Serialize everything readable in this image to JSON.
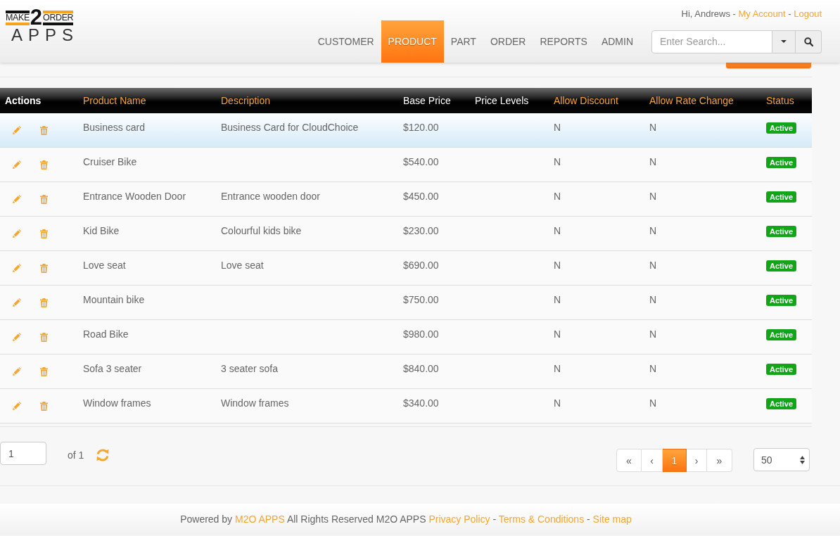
{
  "header": {
    "logo": {
      "left_word": "MAKE",
      "numeral": "2",
      "right_word": "ORDER",
      "bottom_word": "APPS"
    },
    "user_menu": [
      {
        "kind": "text",
        "text": "Hi, Andrews - "
      },
      {
        "kind": "link",
        "text": "My Account"
      },
      {
        "kind": "text",
        "text": " - "
      },
      {
        "kind": "link",
        "text": "Logout"
      }
    ],
    "nav": [
      {
        "label": "CUSTOMER",
        "selected": false
      },
      {
        "label": "PRODUCT",
        "selected": true
      },
      {
        "label": "PART",
        "selected": false
      },
      {
        "label": "ORDER",
        "selected": false
      },
      {
        "label": "REPORTS",
        "selected": false
      },
      {
        "label": "ADMIN",
        "selected": false
      }
    ],
    "search": {
      "placeholder": "Enter Search..."
    }
  },
  "table": {
    "columns": [
      {
        "label": "Actions",
        "kind": "actions",
        "sortable": false
      },
      {
        "label": "Product Name",
        "kind": "text",
        "sortable": true
      },
      {
        "label": "Description",
        "kind": "text",
        "sortable": true
      },
      {
        "label": "Base Price",
        "kind": "text",
        "sortable": false
      },
      {
        "label": "Price Levels",
        "kind": "text",
        "sortable": false
      },
      {
        "label": "Allow Discount",
        "kind": "text",
        "sortable": true
      },
      {
        "label": "Allow Rate Change",
        "kind": "text",
        "sortable": true
      },
      {
        "label": "Status",
        "kind": "status",
        "sortable": true
      }
    ],
    "rows": [
      {
        "selected": true,
        "product_name": "Business card",
        "description": "Business Card for CloudChoice",
        "base_price": "$120.00",
        "allow_discount": "N",
        "allow_rate_change": "N",
        "status": "Active"
      },
      {
        "selected": false,
        "product_name": "Cruiser Bike",
        "base_price": "$540.00",
        "allow_discount": "N",
        "allow_rate_change": "N",
        "status": "Active"
      },
      {
        "selected": false,
        "product_name": "Entrance Wooden Door",
        "description": "Entrance wooden door",
        "base_price": "$450.00",
        "allow_discount": "N",
        "allow_rate_change": "N",
        "status": "Active"
      },
      {
        "selected": false,
        "product_name": "Kid Bike",
        "description": "Colourful kids bike",
        "base_price": "$230.00",
        "allow_discount": "N",
        "allow_rate_change": "N",
        "status": "Active"
      },
      {
        "selected": false,
        "product_name": "Love seat",
        "description": "Love seat",
        "base_price": "$690.00",
        "allow_discount": "N",
        "allow_rate_change": "N",
        "status": "Active"
      },
      {
        "selected": false,
        "product_name": "Mountain bike",
        "base_price": "$750.00",
        "allow_discount": "N",
        "allow_rate_change": "N",
        "status": "Active"
      },
      {
        "selected": false,
        "product_name": "Road Bike",
        "base_price": "$980.00",
        "allow_discount": "N",
        "allow_rate_change": "N",
        "status": "Active"
      },
      {
        "selected": false,
        "product_name": "Sofa 3 seater",
        "description": "3 seater sofa",
        "base_price": "$840.00",
        "allow_discount": "N",
        "allow_rate_change": "N",
        "status": "Active"
      },
      {
        "selected": false,
        "product_name": "Window frames",
        "description": "Window frames",
        "base_price": "$340.00",
        "allow_discount": "N",
        "allow_rate_change": "N",
        "status": "Active"
      }
    ]
  },
  "pager": {
    "page": "1",
    "total": "of 1",
    "buttons": [
      {
        "label": "«",
        "selected": false
      },
      {
        "label": "‹",
        "selected": false
      },
      {
        "label": "1",
        "selected": true
      },
      {
        "label": "›",
        "selected": false
      },
      {
        "label": "»",
        "selected": false
      }
    ],
    "page_size": "50"
  },
  "footer": [
    {
      "kind": "text",
      "text": "Powered by "
    },
    {
      "kind": "link",
      "text": "M2O APPS"
    },
    {
      "kind": "text",
      "text": " All Rights Reserved M2O APPS "
    },
    {
      "kind": "link",
      "text": "Privacy Policy"
    },
    {
      "kind": "text",
      "text": " - "
    },
    {
      "kind": "link",
      "text": "Terms & Conditions"
    },
    {
      "kind": "text",
      "text": " - "
    },
    {
      "kind": "link",
      "text": "Site map"
    }
  ]
}
